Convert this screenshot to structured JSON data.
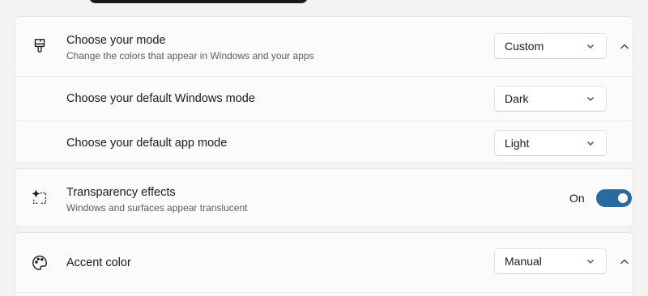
{
  "mode_card": {
    "title": "Choose your mode",
    "subtitle": "Change the colors that appear in Windows and your apps",
    "selected": "Custom",
    "icon": "paintbrush-icon",
    "expander": "chevron-up-icon"
  },
  "windows_mode": {
    "label": "Choose your default Windows mode",
    "selected": "Dark"
  },
  "app_mode": {
    "label": "Choose your default app mode",
    "selected": "Light"
  },
  "transparency": {
    "title": "Transparency effects",
    "subtitle": "Windows and surfaces appear translucent",
    "state_label": "On",
    "enabled": true,
    "icon": "transparency-sparkle-icon"
  },
  "accent": {
    "title": "Accent color",
    "selected": "Manual",
    "icon": "palette-icon",
    "expander": "chevron-up-icon"
  },
  "colors": {
    "accent": "#2b6aa0",
    "card": "#fbfbfb",
    "background": "#f3f3f3"
  }
}
